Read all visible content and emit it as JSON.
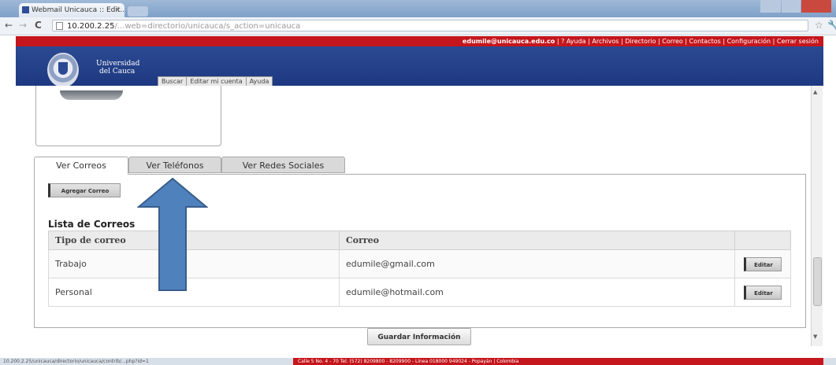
{
  "browser": {
    "tab_title": "Webmail Unicauca :: Edit...",
    "tab_close": "×",
    "url_host": "10.200.2.25",
    "url_path": "/...web=directorio/unicauca/s_action=unicauca",
    "nav_back": "←",
    "nav_forward": "→",
    "nav_reload": "C",
    "star": "☆",
    "wrench": "🔧"
  },
  "site": {
    "user_email": "edumile@unicauca.edu.co",
    "util_links": "| ? Ayuda | Archivos | Directorio | Correo | Contactos | Configuración | Cerrar sesión",
    "university_line1": "Universidad",
    "university_line2": "del Cauca",
    "top_tabs": [
      "Buscar",
      "Editar mi cuenta",
      "Ayuda"
    ]
  },
  "tabs": [
    "Ver Correos",
    "Ver Teléfonos",
    "Ver Redes Sociales"
  ],
  "add_button": "Agregar Correo",
  "list": {
    "title": "Lista de Correos",
    "headers": [
      "Tipo de correo",
      "Correo",
      ""
    ],
    "rows": [
      {
        "type": "Trabajo",
        "email": "edumile@gmail.com",
        "action": "Editar"
      },
      {
        "type": "Personal",
        "email": "edumile@hotmail.com",
        "action": "Editar"
      }
    ]
  },
  "save_button": "Guardar Información",
  "statusbar": {
    "url": "10.200.2.25/unicauca/directorio/unicauca/contrib/...php?id=1",
    "footer": "Calle 5 No. 4 - 70 Tel. (572) 8209800 - 8209900 - Línea 018000 949024 - Popayán | Colombia"
  },
  "colors": {
    "header_blue": "#1d3880",
    "accent_red": "#c4161c",
    "arrow_blue": "#4f81bd"
  }
}
